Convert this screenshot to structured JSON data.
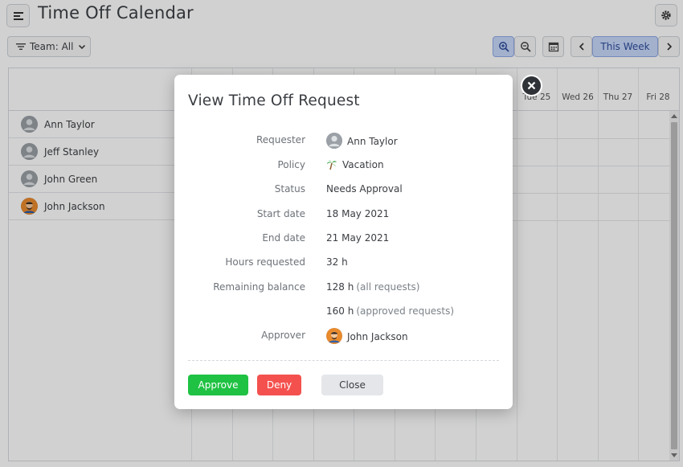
{
  "app": {
    "title": "Time Off Calendar",
    "team_filter_label": "Team: All",
    "this_week_label": "This Week"
  },
  "calendar": {
    "days": [
      "Tue 25",
      "Wed 26",
      "Thu 27",
      "Fri 28"
    ],
    "employees": [
      {
        "name": "Ann Taylor",
        "avatar": "default"
      },
      {
        "name": "Jeff Stanley",
        "avatar": "default"
      },
      {
        "name": "John Green",
        "avatar": "default"
      },
      {
        "name": "John Jackson",
        "avatar": "photo"
      }
    ]
  },
  "modal": {
    "title": "View Time Off Request",
    "fields": {
      "requester_label": "Requester",
      "requester_value": "Ann Taylor",
      "policy_label": "Policy",
      "policy_value": "Vacation",
      "status_label": "Status",
      "status_value": "Needs Approval",
      "start_label": "Start date",
      "start_value": "18 May 2021",
      "end_label": "End date",
      "end_value": "21 May 2021",
      "hours_label": "Hours requested",
      "hours_value": "32 h",
      "balance_label": "Remaining balance",
      "balance_all_value": "128 h",
      "balance_all_note": "(all requests)",
      "balance_approved_value": "160 h",
      "balance_approved_note": "(approved requests)",
      "approver_label": "Approver",
      "approver_value": "John Jackson"
    },
    "buttons": {
      "approve": "Approve",
      "deny": "Deny",
      "close": "Close"
    }
  },
  "colors": {
    "approve": "#1fc243",
    "deny": "#f4514e",
    "close": "#e4e6ea",
    "active_toggle": "#c9d8fb"
  }
}
